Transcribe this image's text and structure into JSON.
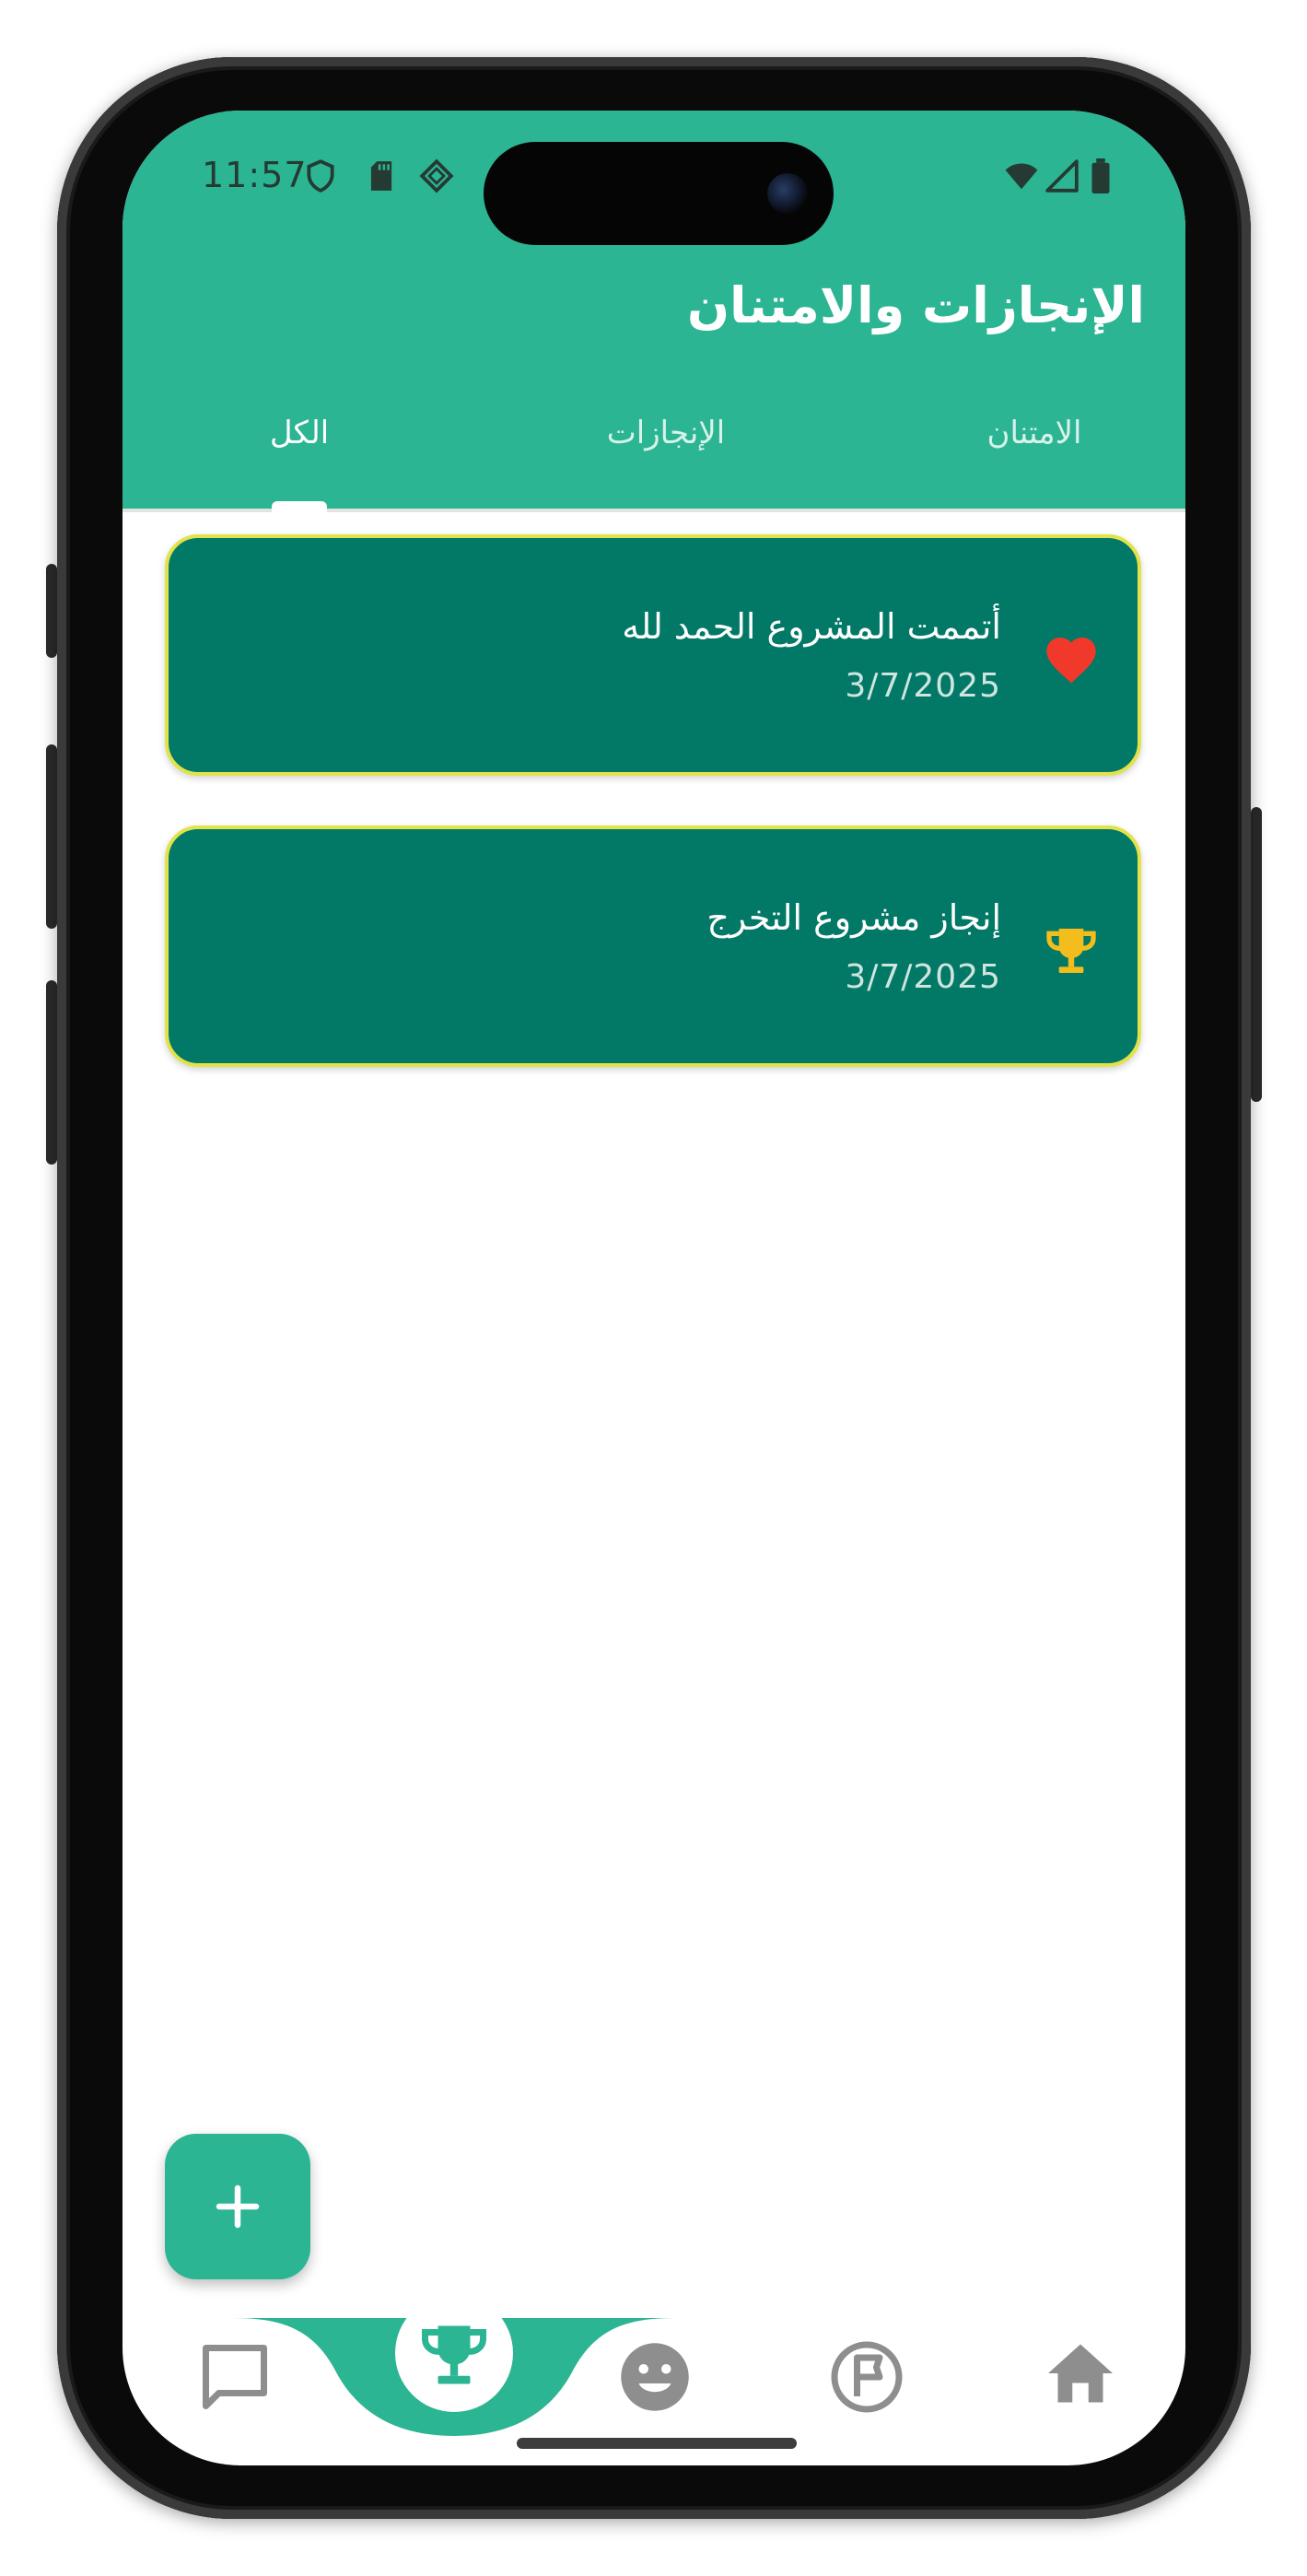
{
  "status_bar": {
    "time": "11:57",
    "icons": [
      "shield-icon",
      "sd-card-icon",
      "diamond-icon",
      "wifi-icon",
      "signal-icon",
      "battery-icon"
    ]
  },
  "header": {
    "title": "الإنجازات والامتنان",
    "tabs": [
      {
        "label": "الكل",
        "selected": true
      },
      {
        "label": "الإنجازات",
        "selected": false
      },
      {
        "label": "الامتنان",
        "selected": false
      }
    ]
  },
  "cards": [
    {
      "title": "أتممت المشروع الحمد لله",
      "date": "3/7/2025",
      "icon": "heart-icon"
    },
    {
      "title": "إنجاز مشروع التخرج",
      "date": "3/7/2025",
      "icon": "trophy-icon"
    }
  ],
  "fab": {
    "icon": "plus-icon"
  },
  "bottom_nav": {
    "items": [
      "chat-icon",
      "trophy-icon",
      "smiley-icon",
      "flag-icon",
      "home-icon"
    ],
    "active": "trophy-icon"
  },
  "colors": {
    "primary": "#2cb592",
    "card": "#027867",
    "card_border": "#e2e24a",
    "heart": "#f0392b",
    "trophy": "#f3bd1c",
    "nav_inactive": "#8e8e8e"
  }
}
